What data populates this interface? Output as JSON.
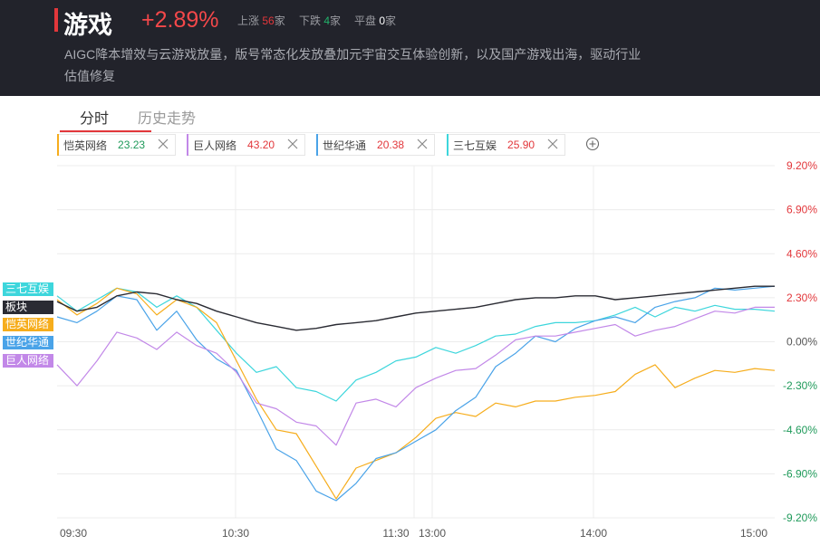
{
  "header": {
    "title": "游戏",
    "change": "+2.89%",
    "stats": {
      "up_label": "上涨",
      "up_count": "56",
      "up_unit": "家",
      "down_label": "下跌",
      "down_count": "4",
      "down_unit": "家",
      "flat_label": "平盘",
      "flat_count": "0",
      "flat_unit": "家"
    },
    "description": "AIGC降本增效与云游戏放量，版号常态化发放叠加元宇宙交互体验创新，以及国产游戏出海，驱动行业估值修复"
  },
  "tabs": [
    {
      "label": "分时",
      "active": true
    },
    {
      "label": "历史走势",
      "active": false
    }
  ],
  "stocks": [
    {
      "name": "恺英网络",
      "price": "23.23",
      "color": "#f6ad1c",
      "price_color": "#1f9a5a"
    },
    {
      "name": "巨人网络",
      "price": "43.20",
      "color": "#c288e8",
      "price_color": "#e2373b"
    },
    {
      "name": "世纪华通",
      "price": "20.38",
      "color": "#4aa3e8",
      "price_color": "#e2373b"
    },
    {
      "name": "三七互娱",
      "price": "25.90",
      "color": "#3dd6dc",
      "price_color": "#e2373b"
    }
  ],
  "badges": [
    {
      "label": "三七互娱",
      "color": "#3dd6dc"
    },
    {
      "label": "板块",
      "color": "#2a2b33"
    },
    {
      "label": "恺英网络",
      "color": "#f6ad1c"
    },
    {
      "label": "世纪华通",
      "color": "#4aa3e8"
    },
    {
      "label": "巨人网络",
      "color": "#c288e8"
    }
  ],
  "chart_data": {
    "type": "line",
    "x_ticks": [
      "09:30",
      "10:30",
      "11:30",
      "13:00",
      "14:00",
      "15:00"
    ],
    "y_ticks": [
      "9.20%",
      "6.90%",
      "4.60%",
      "2.30%",
      "0.00%",
      "-2.30%",
      "-4.60%",
      "-6.90%",
      "-9.20%"
    ],
    "ylim": [
      -9.2,
      9.2
    ],
    "y_unit": "%",
    "grid": true,
    "series": [
      {
        "name": "板块",
        "color": "#2a2b33",
        "values": [
          2.1,
          1.6,
          1.8,
          2.4,
          2.6,
          2.5,
          2.2,
          2.0,
          1.6,
          1.3,
          1.0,
          0.8,
          0.6,
          0.7,
          0.9,
          1.0,
          1.1,
          1.3,
          1.5,
          1.6,
          1.7,
          1.8,
          2.0,
          2.2,
          2.3,
          2.3,
          2.4,
          2.4,
          2.2,
          2.3,
          2.4,
          2.5,
          2.6,
          2.7,
          2.8,
          2.9,
          2.9
        ]
      },
      {
        "name": "恺英网络",
        "color": "#f6ad1c",
        "values": [
          2.2,
          1.4,
          2.0,
          2.8,
          2.5,
          1.4,
          2.2,
          1.8,
          1.0,
          -1.0,
          -3.0,
          -4.6,
          -4.8,
          -6.5,
          -8.2,
          -6.6,
          -6.2,
          -5.8,
          -5.0,
          -4.0,
          -3.7,
          -3.9,
          -3.2,
          -3.4,
          -3.1,
          -3.1,
          -2.9,
          -2.8,
          -2.6,
          -1.7,
          -1.2,
          -2.4,
          -1.9,
          -1.5,
          -1.6,
          -1.4,
          -1.5
        ]
      },
      {
        "name": "巨人网络",
        "color": "#c288e8",
        "values": [
          -1.2,
          -2.3,
          -1.0,
          0.5,
          0.2,
          -0.4,
          0.5,
          -0.2,
          -0.6,
          -1.6,
          -3.2,
          -3.5,
          -4.2,
          -4.4,
          -5.4,
          -3.2,
          -3.0,
          -3.4,
          -2.4,
          -1.9,
          -1.5,
          -1.4,
          -0.7,
          0.1,
          0.3,
          0.3,
          0.5,
          0.7,
          0.9,
          0.3,
          0.6,
          0.8,
          1.2,
          1.6,
          1.5,
          1.8,
          1.8
        ]
      },
      {
        "name": "世纪华通",
        "color": "#4aa3e8",
        "values": [
          1.3,
          1.0,
          1.6,
          2.4,
          2.2,
          0.6,
          1.6,
          0.1,
          -0.9,
          -1.5,
          -3.5,
          -5.6,
          -6.2,
          -7.8,
          -8.3,
          -7.4,
          -6.1,
          -5.8,
          -5.2,
          -4.6,
          -3.6,
          -2.9,
          -1.3,
          -0.6,
          0.3,
          0.0,
          0.7,
          1.1,
          1.3,
          1.0,
          1.8,
          2.1,
          2.3,
          2.8,
          2.7,
          2.8,
          2.9
        ]
      },
      {
        "name": "三七互娱",
        "color": "#3dd6dc",
        "values": [
          2.4,
          1.6,
          2.2,
          2.8,
          2.6,
          1.8,
          2.4,
          1.8,
          0.6,
          -0.6,
          -1.6,
          -1.3,
          -2.4,
          -2.6,
          -3.1,
          -2.0,
          -1.6,
          -1.0,
          -0.8,
          -0.3,
          -0.6,
          -0.2,
          0.3,
          0.4,
          0.8,
          1.0,
          1.0,
          1.1,
          1.4,
          1.8,
          1.3,
          1.8,
          1.6,
          1.9,
          1.7,
          1.7,
          1.6
        ]
      }
    ]
  }
}
